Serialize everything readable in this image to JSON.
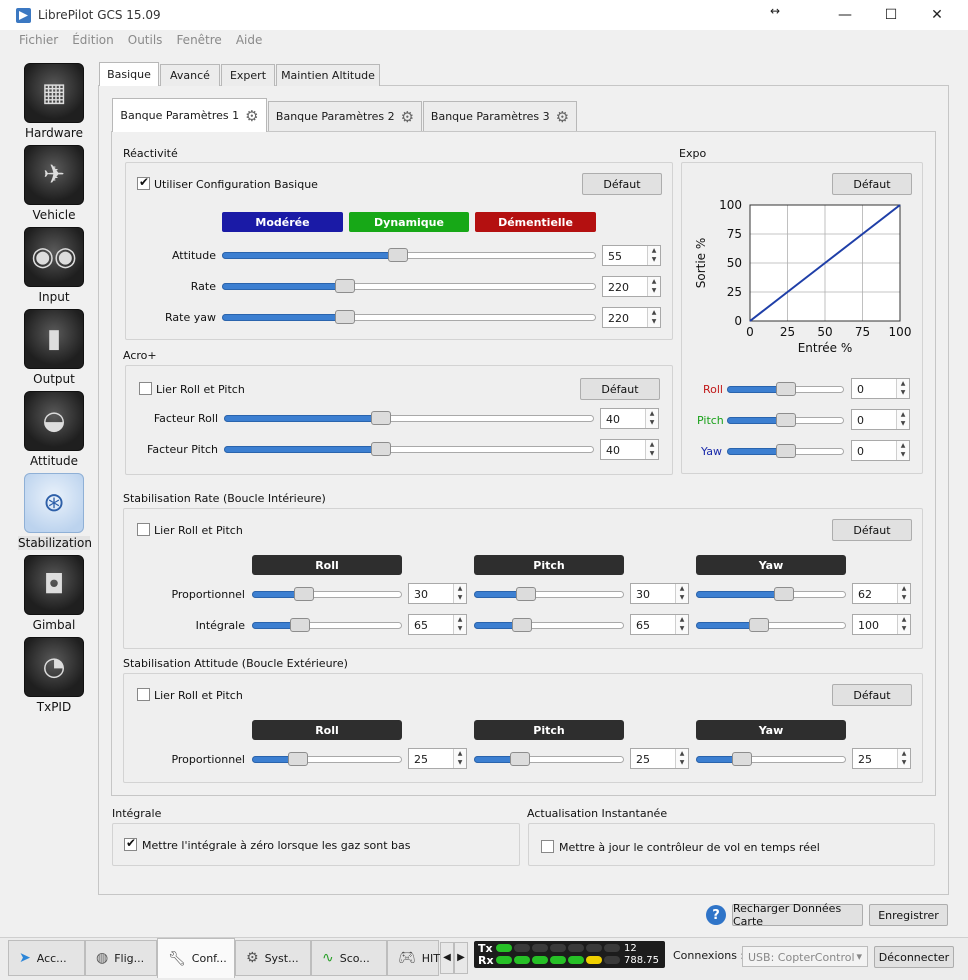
{
  "window": {
    "title": "LibrePilot GCS 15.09"
  },
  "menu": [
    "Fichier",
    "Édition",
    "Outils",
    "Fenêtre",
    "Aide"
  ],
  "sidebar": [
    {
      "label": "Hardware",
      "icon": "chip-icon"
    },
    {
      "label": "Vehicle",
      "icon": "aircraft-icon"
    },
    {
      "label": "Input",
      "icon": "transmitter-icon"
    },
    {
      "label": "Output",
      "icon": "motor-icon"
    },
    {
      "label": "Attitude",
      "icon": "level-icon"
    },
    {
      "label": "Stabilization",
      "icon": "gyro-icon"
    },
    {
      "label": "Gimbal",
      "icon": "camera-icon"
    },
    {
      "label": "TxPID",
      "icon": "meter-icon"
    }
  ],
  "main_tabs": [
    "Basique",
    "Avancé",
    "Expert",
    "Maintien Altitude"
  ],
  "bank_tabs": [
    "Banque Paramètres 1",
    "Banque Paramètres 2",
    "Banque Paramètres 3"
  ],
  "reactivite": {
    "title": "Réactivité",
    "use_basic": "Utiliser Configuration Basique",
    "default": "Défaut",
    "presets": [
      {
        "label": "Modérée",
        "color": "#1a1aa6"
      },
      {
        "label": "Dynamique",
        "color": "#17a817"
      },
      {
        "label": "Démentielle",
        "color": "#b41010"
      }
    ],
    "rows": [
      {
        "label": "Attitude",
        "value": "55",
        "fill": 0.47
      },
      {
        "label": "Rate",
        "value": "220",
        "fill": 0.32
      },
      {
        "label": "Rate yaw",
        "value": "220",
        "fill": 0.32
      }
    ]
  },
  "acro": {
    "title": "Acro+",
    "link": "Lier Roll et Pitch",
    "default": "Défaut",
    "rows": [
      {
        "label": "Facteur Roll",
        "value": "40",
        "fill": 0.42
      },
      {
        "label": "Facteur Pitch",
        "value": "40",
        "fill": 0.42
      }
    ]
  },
  "expo": {
    "title": "Expo",
    "default": "Défaut",
    "chart_data": {
      "type": "line",
      "xlabel": "Entrée %",
      "ylabel": "Sortie %",
      "xlim": [
        0,
        100
      ],
      "ylim": [
        0,
        100
      ],
      "x_ticks": [
        "0",
        "25",
        "50",
        "75",
        "100"
      ],
      "y_ticks": [
        "0",
        "25",
        "50",
        "75",
        "100"
      ],
      "grid": true,
      "series": [
        {
          "x": [
            0,
            25,
            50,
            75,
            100
          ],
          "y": [
            0,
            25,
            50,
            75,
            100
          ],
          "color": "#1f3fa8"
        }
      ]
    },
    "rows": [
      {
        "label": "Roll",
        "color": "#c01818",
        "value": "0",
        "fill": 0.5
      },
      {
        "label": "Pitch",
        "color": "#18a018",
        "value": "0",
        "fill": 0.5
      },
      {
        "label": "Yaw",
        "color": "#1a2aaa",
        "value": "0",
        "fill": 0.5
      }
    ]
  },
  "rate_stab": {
    "title": "Stabilisation Rate (Boucle Intérieure)",
    "link": "Lier Roll et Pitch",
    "default": "Défaut",
    "axes": [
      "Roll",
      "Pitch",
      "Yaw"
    ],
    "rows": [
      {
        "label": "Proportionnel",
        "values": [
          "30",
          "30",
          "62"
        ],
        "fills": [
          0.32,
          0.32,
          0.6
        ]
      },
      {
        "label": "Intégrale",
        "values": [
          "65",
          "65",
          "100"
        ],
        "fills": [
          0.29,
          0.29,
          0.41
        ]
      }
    ]
  },
  "att_stab": {
    "title": "Stabilisation Attitude (Boucle Extérieure)",
    "link": "Lier Roll et Pitch",
    "default": "Défaut",
    "axes": [
      "Roll",
      "Pitch",
      "Yaw"
    ],
    "rows": [
      {
        "label": "Proportionnel",
        "values": [
          "25",
          "25",
          "25"
        ],
        "fills": [
          0.28,
          0.28,
          0.28
        ]
      }
    ]
  },
  "integrale": {
    "title": "Intégrale",
    "text": "Mettre l'intégrale à zéro lorsque les gaz sont bas"
  },
  "realtime": {
    "title": "Actualisation Instantanée",
    "text": "Mettre à jour le contrôleur de vol en temps réel"
  },
  "actions": {
    "reload": "Recharger Données Carte",
    "save": "Enregistrer"
  },
  "bottom_tabs": [
    {
      "label": "Acc...",
      "icon": "welcome-icon"
    },
    {
      "label": "Flig...",
      "icon": "flight-icon"
    },
    {
      "label": "Conf...",
      "icon": "wrench-icon"
    },
    {
      "label": "Syst...",
      "icon": "system-gear-icon"
    },
    {
      "label": "Sco...",
      "icon": "scope-icon"
    },
    {
      "label": "HIT",
      "icon": "gamepad-icon"
    }
  ],
  "telemetry": {
    "tx_label": "Tx",
    "rx_label": "Rx",
    "tx_value": "12",
    "rx_value": "788.75"
  },
  "connection": {
    "label": "Connexions :",
    "device": "USB: CopterControl",
    "disconnect": "Déconnecter"
  }
}
